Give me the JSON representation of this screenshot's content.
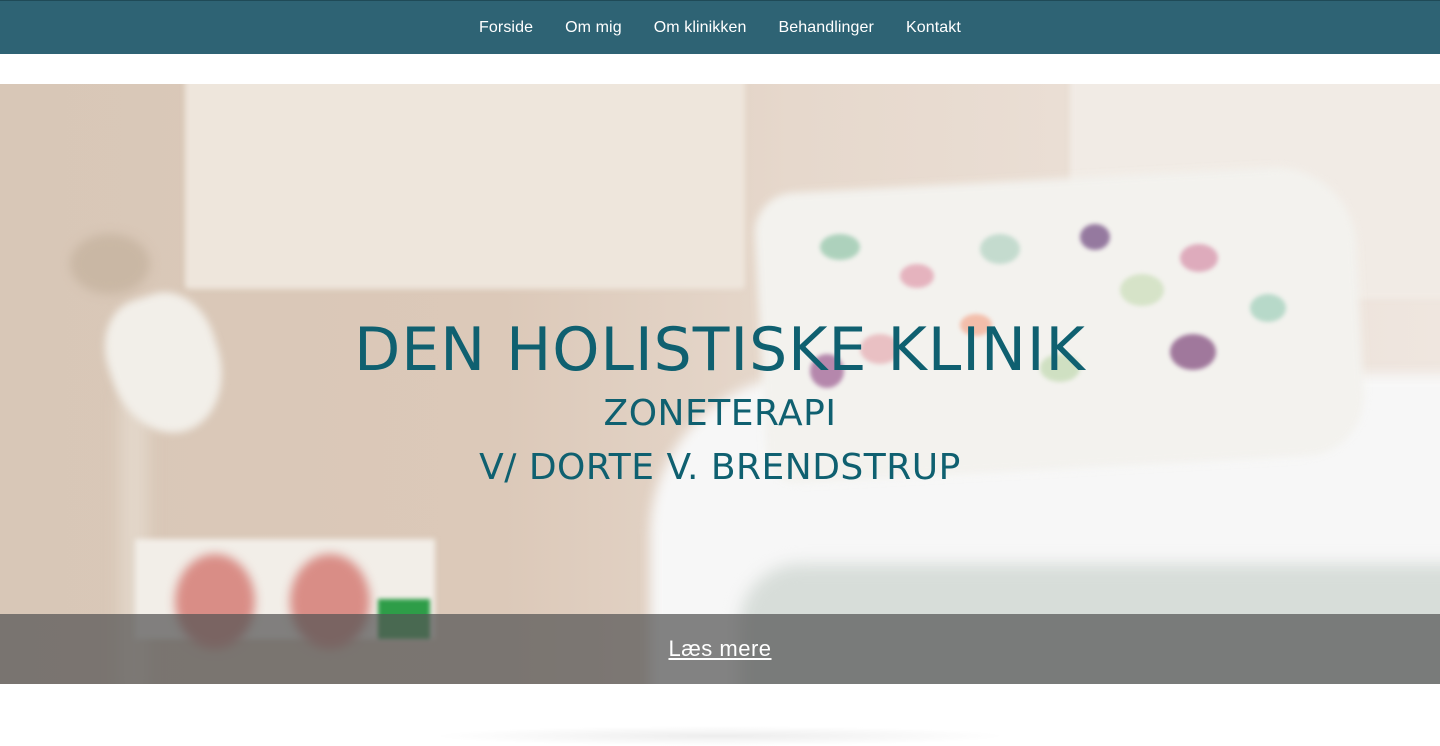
{
  "nav": {
    "items": [
      {
        "label": "Forside"
      },
      {
        "label": "Om mig"
      },
      {
        "label": "Om klinikken"
      },
      {
        "label": "Behandlinger"
      },
      {
        "label": "Kontakt"
      }
    ]
  },
  "hero": {
    "title": "DEN HOLISTISKE KLINIK",
    "subtitle_line1": "ZONETERAPI",
    "subtitle_line2": "V/ DORTE V. BRENDSTRUP",
    "read_more_label": "Læs mere"
  },
  "colors": {
    "nav_background": "#2e6374",
    "hero_text": "#0f6070",
    "readmore_bar": "#555555"
  }
}
